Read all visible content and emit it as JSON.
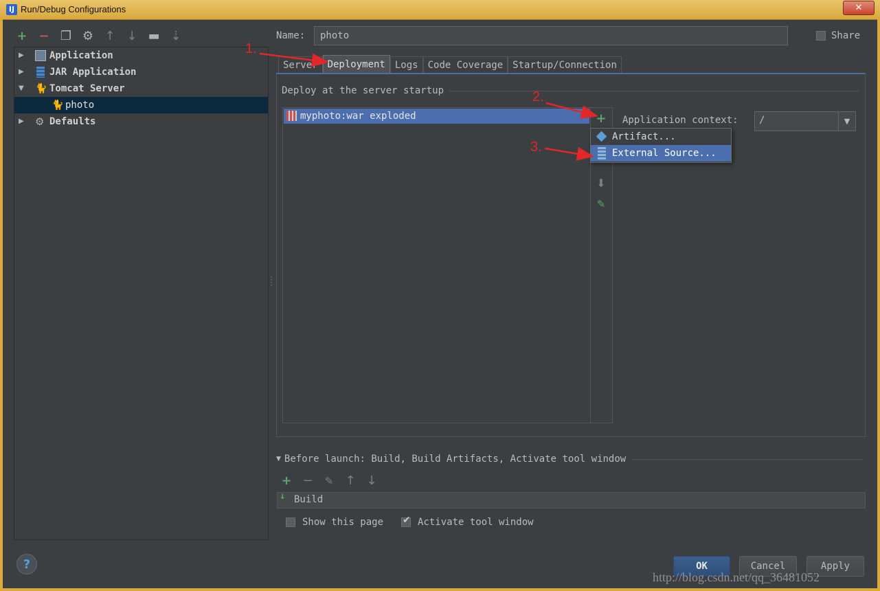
{
  "window": {
    "title": "Run/Debug Configurations",
    "icon_letter": "IJ",
    "close_glyph": "✕"
  },
  "left_toolbar": {
    "icons": [
      "add-icon",
      "remove-icon",
      "copy-icon",
      "wrench-icon",
      "move-up-icon",
      "move-down-icon",
      "folder-icon",
      "sort-icon"
    ]
  },
  "tree": {
    "items": [
      {
        "label": "Application",
        "expanded": false
      },
      {
        "label": "JAR Application",
        "expanded": false
      },
      {
        "label": "Tomcat Server",
        "expanded": true
      },
      {
        "label": "photo",
        "selected": true
      },
      {
        "label": "Defaults",
        "expanded": false
      }
    ]
  },
  "form": {
    "name_label": "Name:",
    "name_value": "photo",
    "share_label": "Share"
  },
  "tabs": [
    {
      "label": "Server"
    },
    {
      "label": "Deployment",
      "active": true
    },
    {
      "label": "Logs"
    },
    {
      "label": "Code Coverage"
    },
    {
      "label": "Startup/Connection"
    }
  ],
  "deployment": {
    "group_title": "Deploy at the server startup",
    "items": [
      "myphoto:war exploded"
    ],
    "app_context_label": "Application context:",
    "app_context_value": "/"
  },
  "popup": {
    "items": [
      {
        "label": "Artifact..."
      },
      {
        "label": "External Source...",
        "highlighted": true
      }
    ]
  },
  "annotations": [
    "1.",
    "2.",
    "3."
  ],
  "annotation_color": "#e2262a",
  "before_launch": {
    "title": "Before launch: Build, Build Artifacts, Activate tool window",
    "items": [
      "Build"
    ],
    "show_page_label": "Show this page",
    "activate_label": "Activate tool window"
  },
  "buttons": {
    "help": "?",
    "ok": "OK",
    "cancel": "Cancel",
    "apply": "Apply"
  },
  "watermark": "http://blog.csdn.net/qq_36481052",
  "colors": {
    "background": "#3c3f41",
    "selection": "#4b6eaf",
    "tree_selection": "#0d293e",
    "accent_green": "#59a869",
    "accent_red": "#c75450"
  }
}
